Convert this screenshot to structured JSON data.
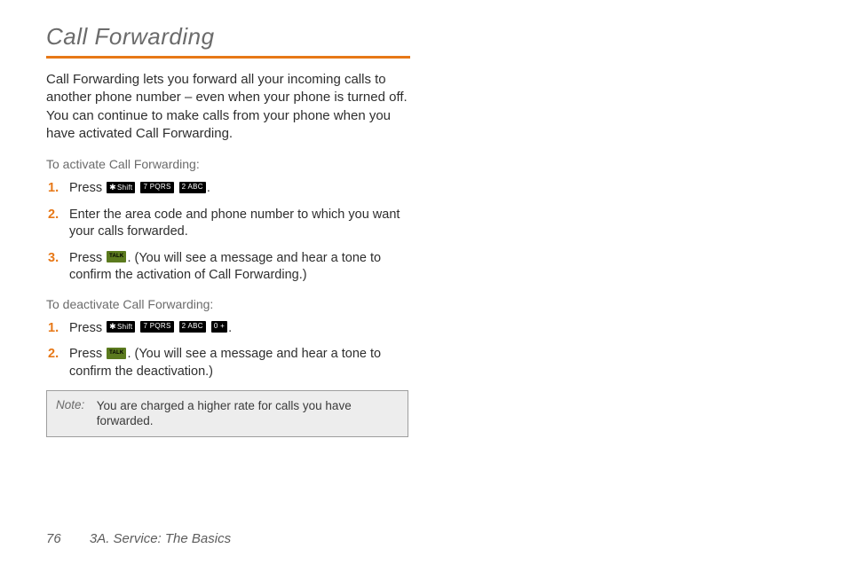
{
  "title": "Call Forwarding",
  "intro": "Call Forwarding lets you forward all your incoming calls to another phone number – even when your phone is turned off. You can continue to make calls from your phone when you have activated Call Forwarding.",
  "activate": {
    "heading": "To activate Call Forwarding:",
    "step1_prefix": "Press ",
    "step1_suffix": ".",
    "step2": "Enter the area code and phone number to which you want your calls forwarded.",
    "step3_prefix": "Press ",
    "step3_suffix": ". (You will see a message and hear a tone to confirm the activation of Call Forwarding.)"
  },
  "deactivate": {
    "heading": "To deactivate Call Forwarding:",
    "step1_prefix": "Press ",
    "step1_suffix": ".",
    "step2_prefix": "Press ",
    "step2_suffix": ". (You will see a message and hear a tone to confirm the deactivation.)"
  },
  "keys": {
    "star_shift": "Shift",
    "seven": "7 PQRS",
    "two": "2 ABC",
    "zero": "0  +",
    "talk": "TALK"
  },
  "note": {
    "label": "Note:",
    "text": "You are charged a higher rate for calls you have forwarded."
  },
  "footer": {
    "page": "76",
    "section": "3A. Service: The Basics"
  }
}
